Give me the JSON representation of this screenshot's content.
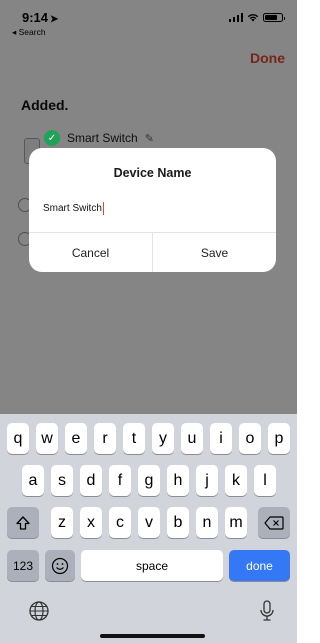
{
  "status_bar": {
    "time": "9:14",
    "back_label": "◂ Search"
  },
  "header": {
    "done_label": "Done"
  },
  "page": {
    "section_title": "Added.",
    "device_name": "Smart Switch"
  },
  "dialog": {
    "title": "Device Name",
    "input_value": "Smart Switch",
    "cancel_label": "Cancel",
    "save_label": "Save"
  },
  "keyboard": {
    "row1": [
      "q",
      "w",
      "e",
      "r",
      "t",
      "y",
      "u",
      "i",
      "o",
      "p"
    ],
    "row2": [
      "a",
      "s",
      "d",
      "f",
      "g",
      "h",
      "j",
      "k",
      "l"
    ],
    "row3": [
      "z",
      "x",
      "c",
      "v",
      "b",
      "n",
      "m"
    ],
    "numbers_label": "123",
    "space_label": "space",
    "return_label": "done"
  },
  "colors": {
    "accent": "#e0492f",
    "return_key": "#3478f6",
    "check": "#1fa35b"
  }
}
